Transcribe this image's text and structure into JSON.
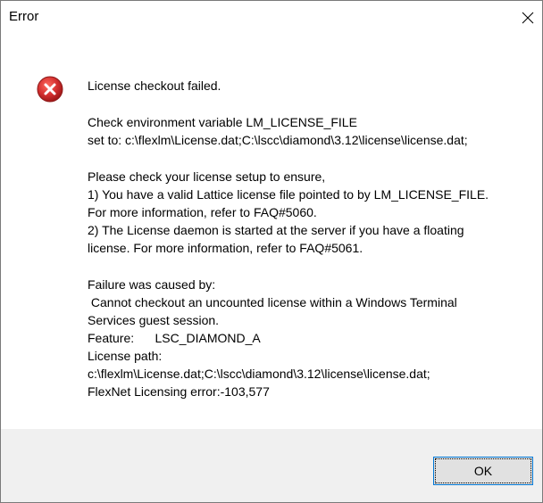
{
  "dialog": {
    "title": "Error",
    "close_icon": "close-icon",
    "icon": "error-icon",
    "ok_label": "OK"
  },
  "message": {
    "lines": [
      "License checkout failed.",
      "",
      "Check environment variable LM_LICENSE_FILE",
      "set to: c:\\flexlm\\License.dat;C:\\lscc\\diamond\\3.12\\license\\license.dat;",
      "",
      "Please check your license setup to ensure,",
      "1) You have a valid Lattice license file pointed to by LM_LICENSE_FILE.",
      "For more information, refer to FAQ#5060.",
      "2) The License daemon is started at the server if you have a floating",
      "license. For more information, refer to FAQ#5061.",
      "",
      "Failure was caused by:",
      " Cannot checkout an uncounted license within a Windows Terminal",
      "Services guest session.",
      "Feature:      LSC_DIAMOND_A",
      "License path:",
      "c:\\flexlm\\License.dat;C:\\lscc\\diamond\\3.12\\license\\license.dat;",
      "FlexNet Licensing error:-103,577"
    ]
  },
  "colors": {
    "icon_red": "#d32f2f",
    "footer_bg": "#f0f0f0",
    "button_border": "#0078d7",
    "button_bg": "#e1e1e1"
  }
}
